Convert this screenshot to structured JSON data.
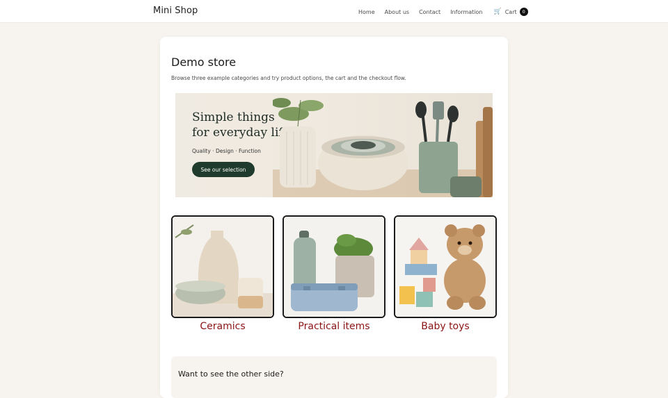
{
  "header": {
    "brand": "Mini Shop",
    "nav": [
      "Home",
      "About us",
      "Contact",
      "Information"
    ],
    "cart_label": "Cart",
    "cart_count": "0"
  },
  "main": {
    "title": "Demo store",
    "subtitle": "Browse three example categories and try product options, the cart and the checkout flow.",
    "banner": {
      "headline_1": "Simple things",
      "headline_2": "for everyday life",
      "tagline": "Quality · Design · Function",
      "button": "See our selection"
    },
    "categories": [
      {
        "label": "Ceramics"
      },
      {
        "label": "Practical items"
      },
      {
        "label": "Baby toys"
      }
    ],
    "other_side_title": "Want to see the other side?"
  },
  "colors": {
    "accent": "#8b1414",
    "banner_button": "#1f3b2d",
    "page_bg": "#f7f4ef"
  }
}
